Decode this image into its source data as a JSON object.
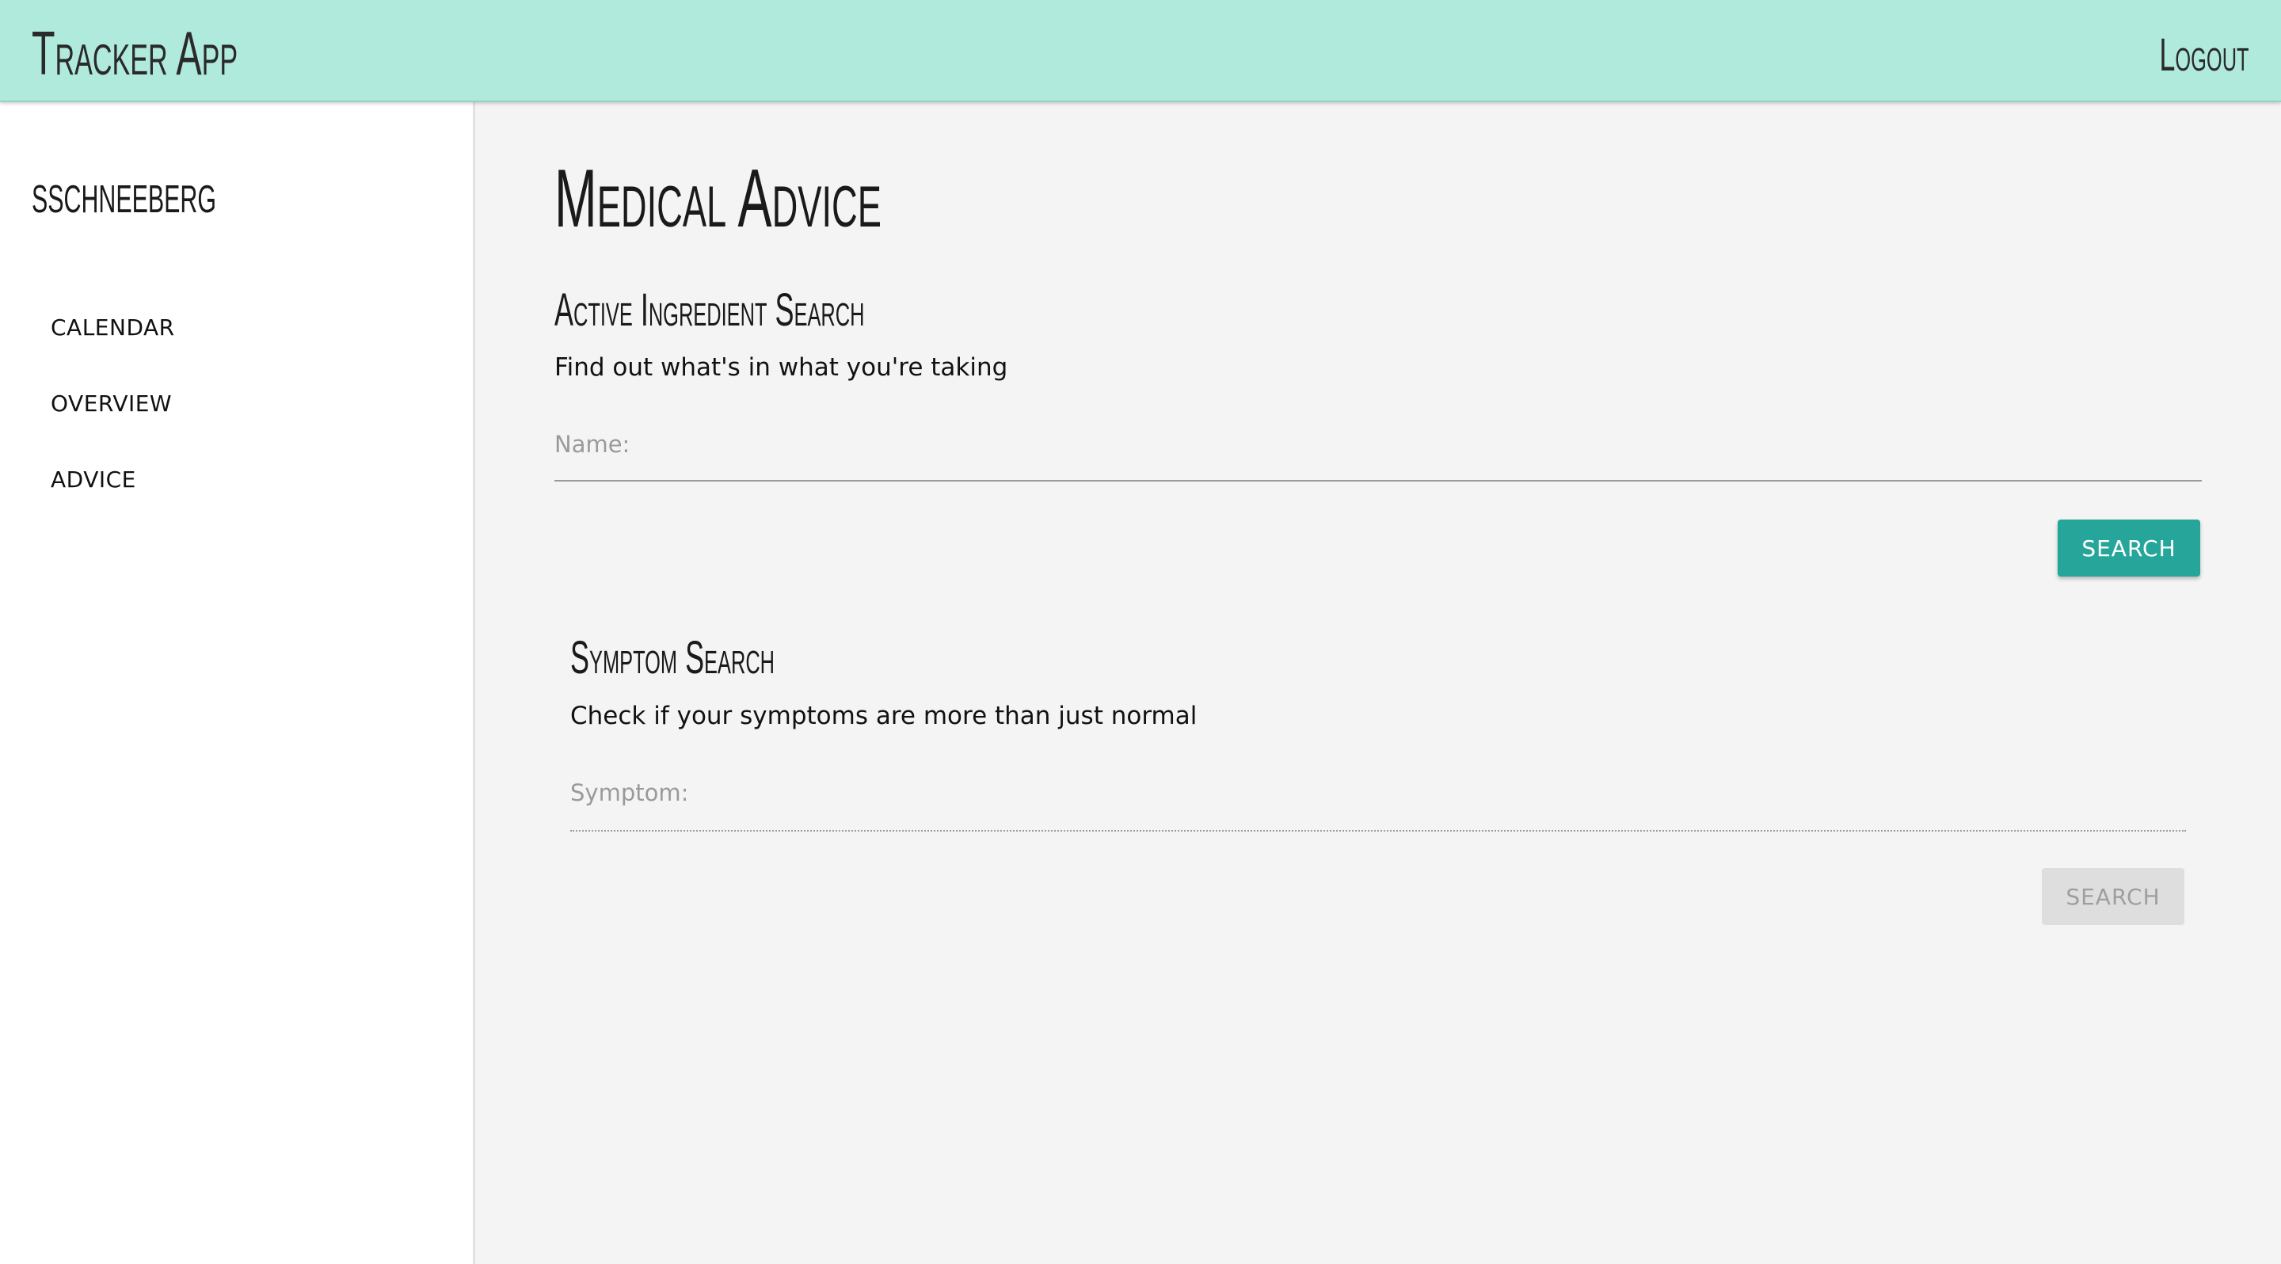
{
  "header": {
    "app_title": "Tracker App",
    "logout_label": "Logout"
  },
  "sidebar": {
    "username": "sschneeberg",
    "items": [
      {
        "label": "CALENDAR"
      },
      {
        "label": "OVERVIEW"
      },
      {
        "label": "ADVICE"
      }
    ]
  },
  "main": {
    "page_title": "Medical Advice",
    "ingredient_search": {
      "heading": "Active Ingredient Search",
      "description": "Find out what's in what you're taking",
      "field_label": "Name:",
      "field_value": "",
      "button_label": "SEARCH",
      "button_enabled": true
    },
    "symptom_search": {
      "heading": "Symptom Search",
      "description": "Check if your symptoms are more than just normal",
      "field_label": "Symptom:",
      "field_value": "",
      "button_label": "SEARCH",
      "button_enabled": false
    }
  },
  "colors": {
    "header_bg": "#b0eadc",
    "primary_button": "#26a69a",
    "disabled_button": "#dedede",
    "main_bg": "#f4f4f4",
    "sidebar_bg": "#ffffff"
  }
}
